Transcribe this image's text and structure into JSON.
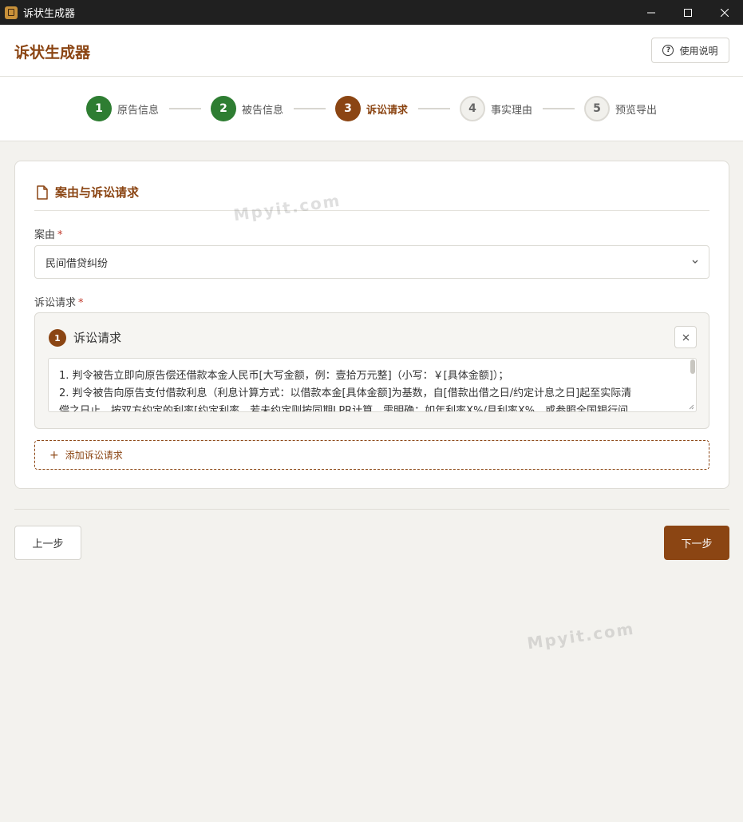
{
  "window": {
    "title": "诉状生成器",
    "icons": {
      "app": "app-icon",
      "minimize": "minimize-icon",
      "maximize": "maximize-icon",
      "close": "close-icon"
    }
  },
  "header": {
    "title": "诉状生成器",
    "help_label": "使用说明",
    "help_icon": "question-circle-icon"
  },
  "stepper": {
    "current_step": 3,
    "steps": [
      {
        "number": "1",
        "label": "原告信息",
        "state": "done"
      },
      {
        "number": "2",
        "label": "被告信息",
        "state": "done"
      },
      {
        "number": "3",
        "label": "诉讼请求",
        "state": "active"
      },
      {
        "number": "4",
        "label": "事实理由",
        "state": "todo"
      },
      {
        "number": "5",
        "label": "预览导出",
        "state": "todo"
      }
    ]
  },
  "section": {
    "title": "案由与诉讼请求",
    "icon": "document-icon",
    "case_type": {
      "label": "案由",
      "required_mark": "*",
      "value": "民间借贷纠纷"
    },
    "claims": {
      "label": "诉讼请求",
      "required_mark": "*",
      "items": [
        {
          "number": "1",
          "title": "诉讼请求",
          "text_lines": [
            "1. 判令被告立即向原告偿还借款本金人民币[大写金额，例：壹拾万元整]（小写：￥[具体金额]）；",
            "2. 判令被告向原告支付借款利息（利息计算方式：以借款本金[具体金额]为基数，自[借款出借之日/约定计息之日]起至实际清",
            "偿之日止，按双方约定的利率[约定利率，若未约定则按同期LPR计算，需明确：如年利率X%/月利率X%，或参照全国银行间"
          ]
        }
      ],
      "add_label": "添加诉讼请求"
    }
  },
  "nav": {
    "prev_label": "上一步",
    "next_label": "下一步"
  },
  "watermarks": [
    "Mpyit.com",
    "Mpyit.com"
  ],
  "colors": {
    "brand": "#8b4513",
    "done_green": "#2e7d32",
    "page_bg": "#f3f2ee",
    "required_red": "#c0392b"
  }
}
